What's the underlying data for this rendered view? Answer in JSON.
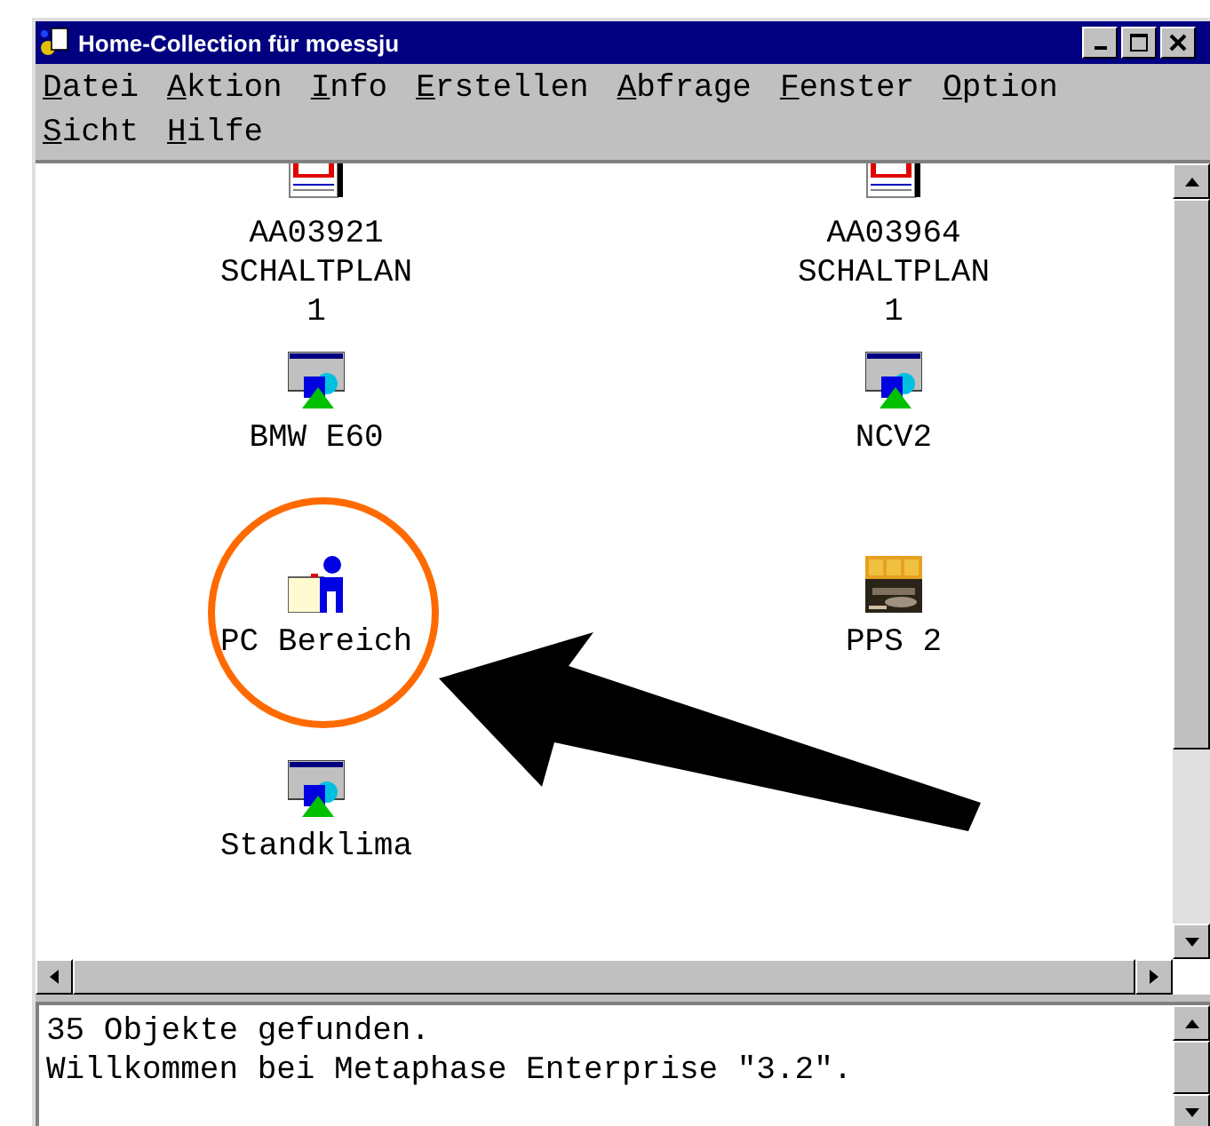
{
  "window": {
    "title": "Home-Collection für moessju"
  },
  "menu": [
    "Datei",
    "Aktion",
    "Info",
    "Erstellen",
    "Abfrage",
    "Fenster",
    "Option",
    "Sicht",
    "Hilfe"
  ],
  "objects": [
    {
      "kind": "cad",
      "label_lines": [
        "AA03921",
        "SCHALTPLAN",
        "1"
      ]
    },
    {
      "kind": "cad",
      "label_lines": [
        "AA03964",
        "SCHALTPLAN",
        "1"
      ]
    },
    {
      "kind": "form",
      "label_lines": [
        "BMW E60"
      ]
    },
    {
      "kind": "form",
      "label_lines": [
        "NCV2"
      ]
    },
    {
      "kind": "person",
      "label_lines": [
        "PC Bereich"
      ]
    },
    {
      "kind": "pps",
      "label_lines": [
        "PPS 2"
      ]
    },
    {
      "kind": "form",
      "label_lines": [
        "Standklima"
      ]
    }
  ],
  "status_lines": [
    "35 Objekte gefunden.",
    "Willkommen bei Metaphase Enterprise \"3.2\"."
  ]
}
